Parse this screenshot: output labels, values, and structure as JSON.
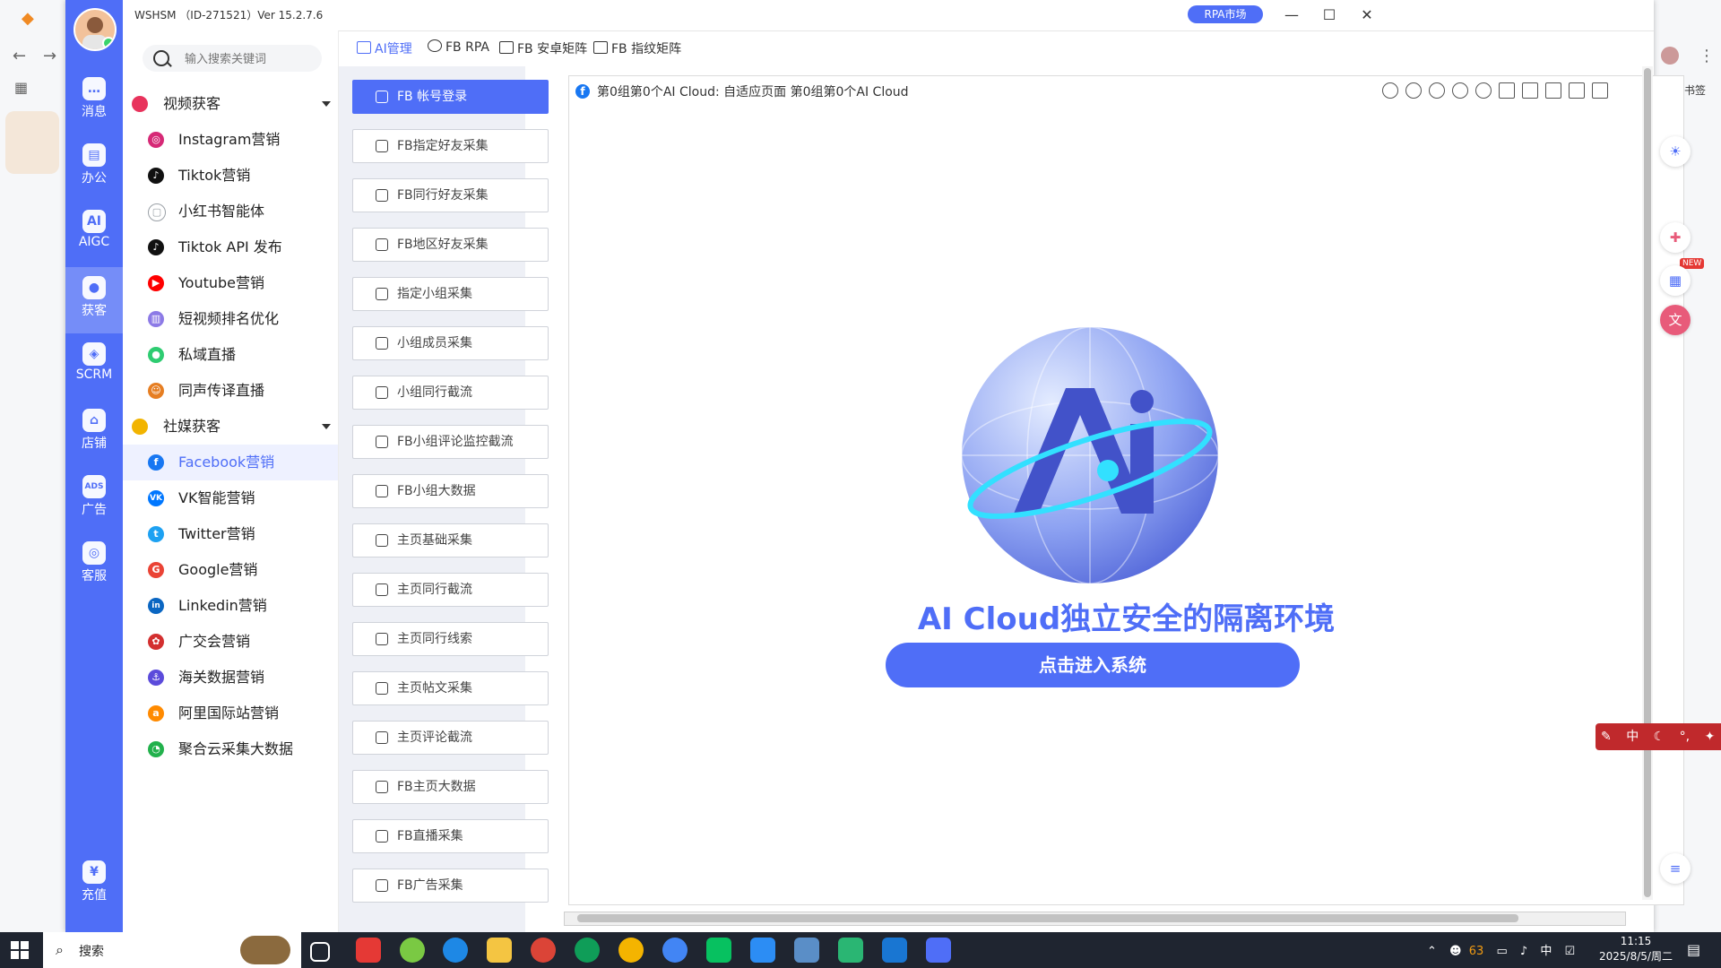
{
  "app": {
    "title": "WSHSM （ID-271521）Ver 15.2.7.6",
    "rpa_market": "RPA市场"
  },
  "rail": {
    "items": [
      {
        "label": "消息",
        "icon": "message-icon"
      },
      {
        "label": "办公",
        "icon": "office-icon"
      },
      {
        "label": "AIGC",
        "icon": "aigc-icon"
      },
      {
        "label": "获客",
        "icon": "user-acquire-icon"
      },
      {
        "label": "SCRM",
        "icon": "scrm-icon"
      },
      {
        "label": "店铺",
        "icon": "store-icon"
      },
      {
        "label": "广告",
        "icon": "ads-icon"
      },
      {
        "label": "客服",
        "icon": "service-icon"
      }
    ],
    "recharge": "充值"
  },
  "search": {
    "placeholder": "输入搜索关键词"
  },
  "nav": {
    "group1": "视频获客",
    "group1_items": [
      {
        "label": "Instagram营销",
        "color": "#d62976"
      },
      {
        "label": "Tiktok营销",
        "color": "#111111"
      },
      {
        "label": "小红书智能体",
        "color": "#9aa0a6"
      },
      {
        "label": "Tiktok API 发布",
        "color": "#111111"
      },
      {
        "label": "Youtube营销",
        "color": "#ff0000"
      },
      {
        "label": "短视频排名优化",
        "color": "#8c7ae6"
      },
      {
        "label": "私域直播",
        "color": "#2ecc71"
      },
      {
        "label": "同声传译直播",
        "color": "#e67e22"
      }
    ],
    "group2": "社媒获客",
    "group2_items": [
      {
        "label": "Facebook营销",
        "color": "#1877f2"
      },
      {
        "label": "VK智能营销",
        "color": "#0077ff"
      },
      {
        "label": "Twitter营销",
        "color": "#1da1f2"
      },
      {
        "label": "Google营销",
        "color": "#ea4335"
      },
      {
        "label": "Linkedin营销",
        "color": "#0a66c2"
      },
      {
        "label": "广交会营销",
        "color": "#d32f2f"
      },
      {
        "label": "海关数据营销",
        "color": "#5b4bdb"
      },
      {
        "label": "阿里国际站营销",
        "color": "#ff8a00"
      },
      {
        "label": "聚合云采集大数据",
        "color": "#22b14c"
      }
    ]
  },
  "tabs": [
    "AI管理",
    "FB RPA",
    "FB 安卓矩阵",
    "FB 指纹矩阵"
  ],
  "functions": [
    "FB 帐号登录",
    "FB指定好友采集",
    "FB同行好友采集",
    "FB地区好友采集",
    "指定小组采集",
    "小组成员采集",
    "小组同行截流",
    "FB小组评论监控截流",
    "FB小组大数据",
    "主页基础采集",
    "主页同行截流",
    "主页同行线索",
    "主页帖文采集",
    "主页评论截流",
    "FB主页大数据",
    "FB直播采集",
    "FB广告采集"
  ],
  "panel": {
    "title": "第0组第0个AI Cloud: 自适应页面 第0组第0个AI Cloud",
    "hero": "AI Cloud独立安全的隔离环境",
    "enter": "点击进入系统"
  },
  "browser": {
    "bookmarks": "所有书签"
  },
  "widgets": {
    "new_badge": "NEW"
  },
  "ime": "中",
  "taskbar": {
    "search": "搜索",
    "tray_count": "63",
    "tray_lang": "中",
    "time": "11:15",
    "date": "2025/8/5/周二"
  },
  "colors": {
    "accent": "#4f6ef7"
  }
}
